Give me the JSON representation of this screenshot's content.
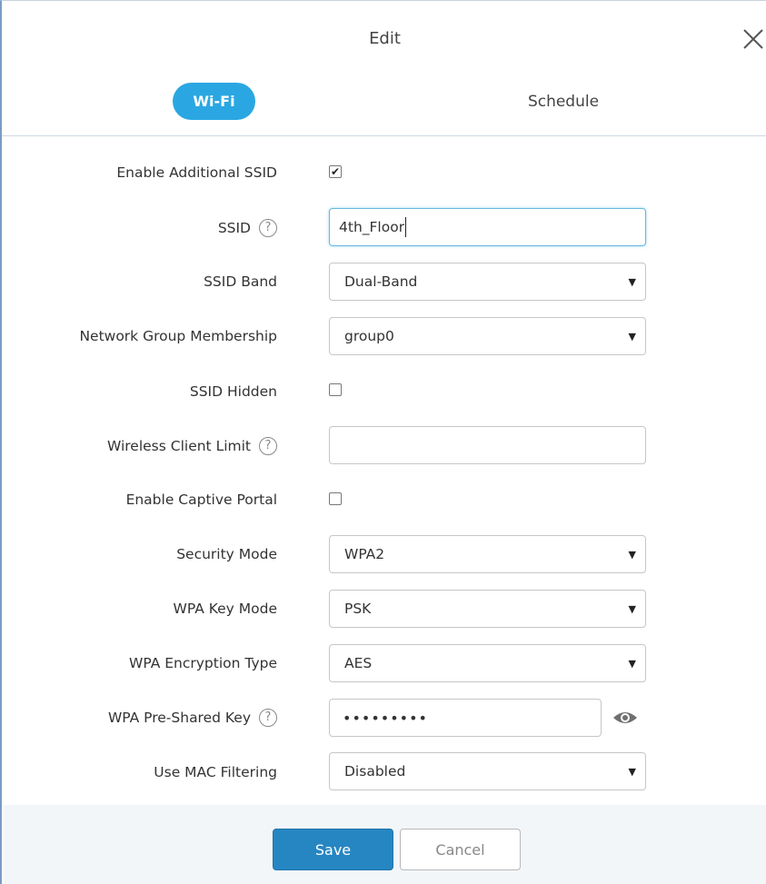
{
  "dialog": {
    "title": "Edit"
  },
  "tabs": {
    "wifi_label": "Wi-Fi",
    "schedule_label": "Schedule"
  },
  "form": {
    "enable_additional_ssid": {
      "label": "Enable Additional SSID",
      "checked": true
    },
    "ssid": {
      "label": "SSID",
      "value": "4th_Floor",
      "help": "?"
    },
    "ssid_band": {
      "label": "SSID Band",
      "value": "Dual-Band"
    },
    "network_group": {
      "label": "Network Group Membership",
      "value": "group0"
    },
    "ssid_hidden": {
      "label": "SSID Hidden",
      "checked": false
    },
    "wireless_client_limit": {
      "label": "Wireless Client Limit",
      "value": "",
      "help": "?"
    },
    "enable_captive_portal": {
      "label": "Enable Captive Portal",
      "checked": false
    },
    "security_mode": {
      "label": "Security Mode",
      "value": "WPA2"
    },
    "wpa_key_mode": {
      "label": "WPA Key Mode",
      "value": "PSK"
    },
    "wpa_encryption_type": {
      "label": "WPA Encryption Type",
      "value": "AES"
    },
    "wpa_psk": {
      "label": "WPA Pre-Shared Key",
      "value": "•••••••••",
      "help": "?"
    },
    "mac_filtering": {
      "label": "Use MAC Filtering",
      "value": "Disabled"
    }
  },
  "footer": {
    "save_label": "Save",
    "cancel_label": "Cancel"
  },
  "icons": {
    "close": "close-icon",
    "help": "help-circle-icon",
    "eye": "eye-icon",
    "dropdown": "caret-down-icon",
    "check": "checkmark-icon"
  },
  "colors": {
    "accent": "#2aa7e2",
    "save_button": "#2686c2",
    "footer_bg": "#f3f6f9"
  }
}
